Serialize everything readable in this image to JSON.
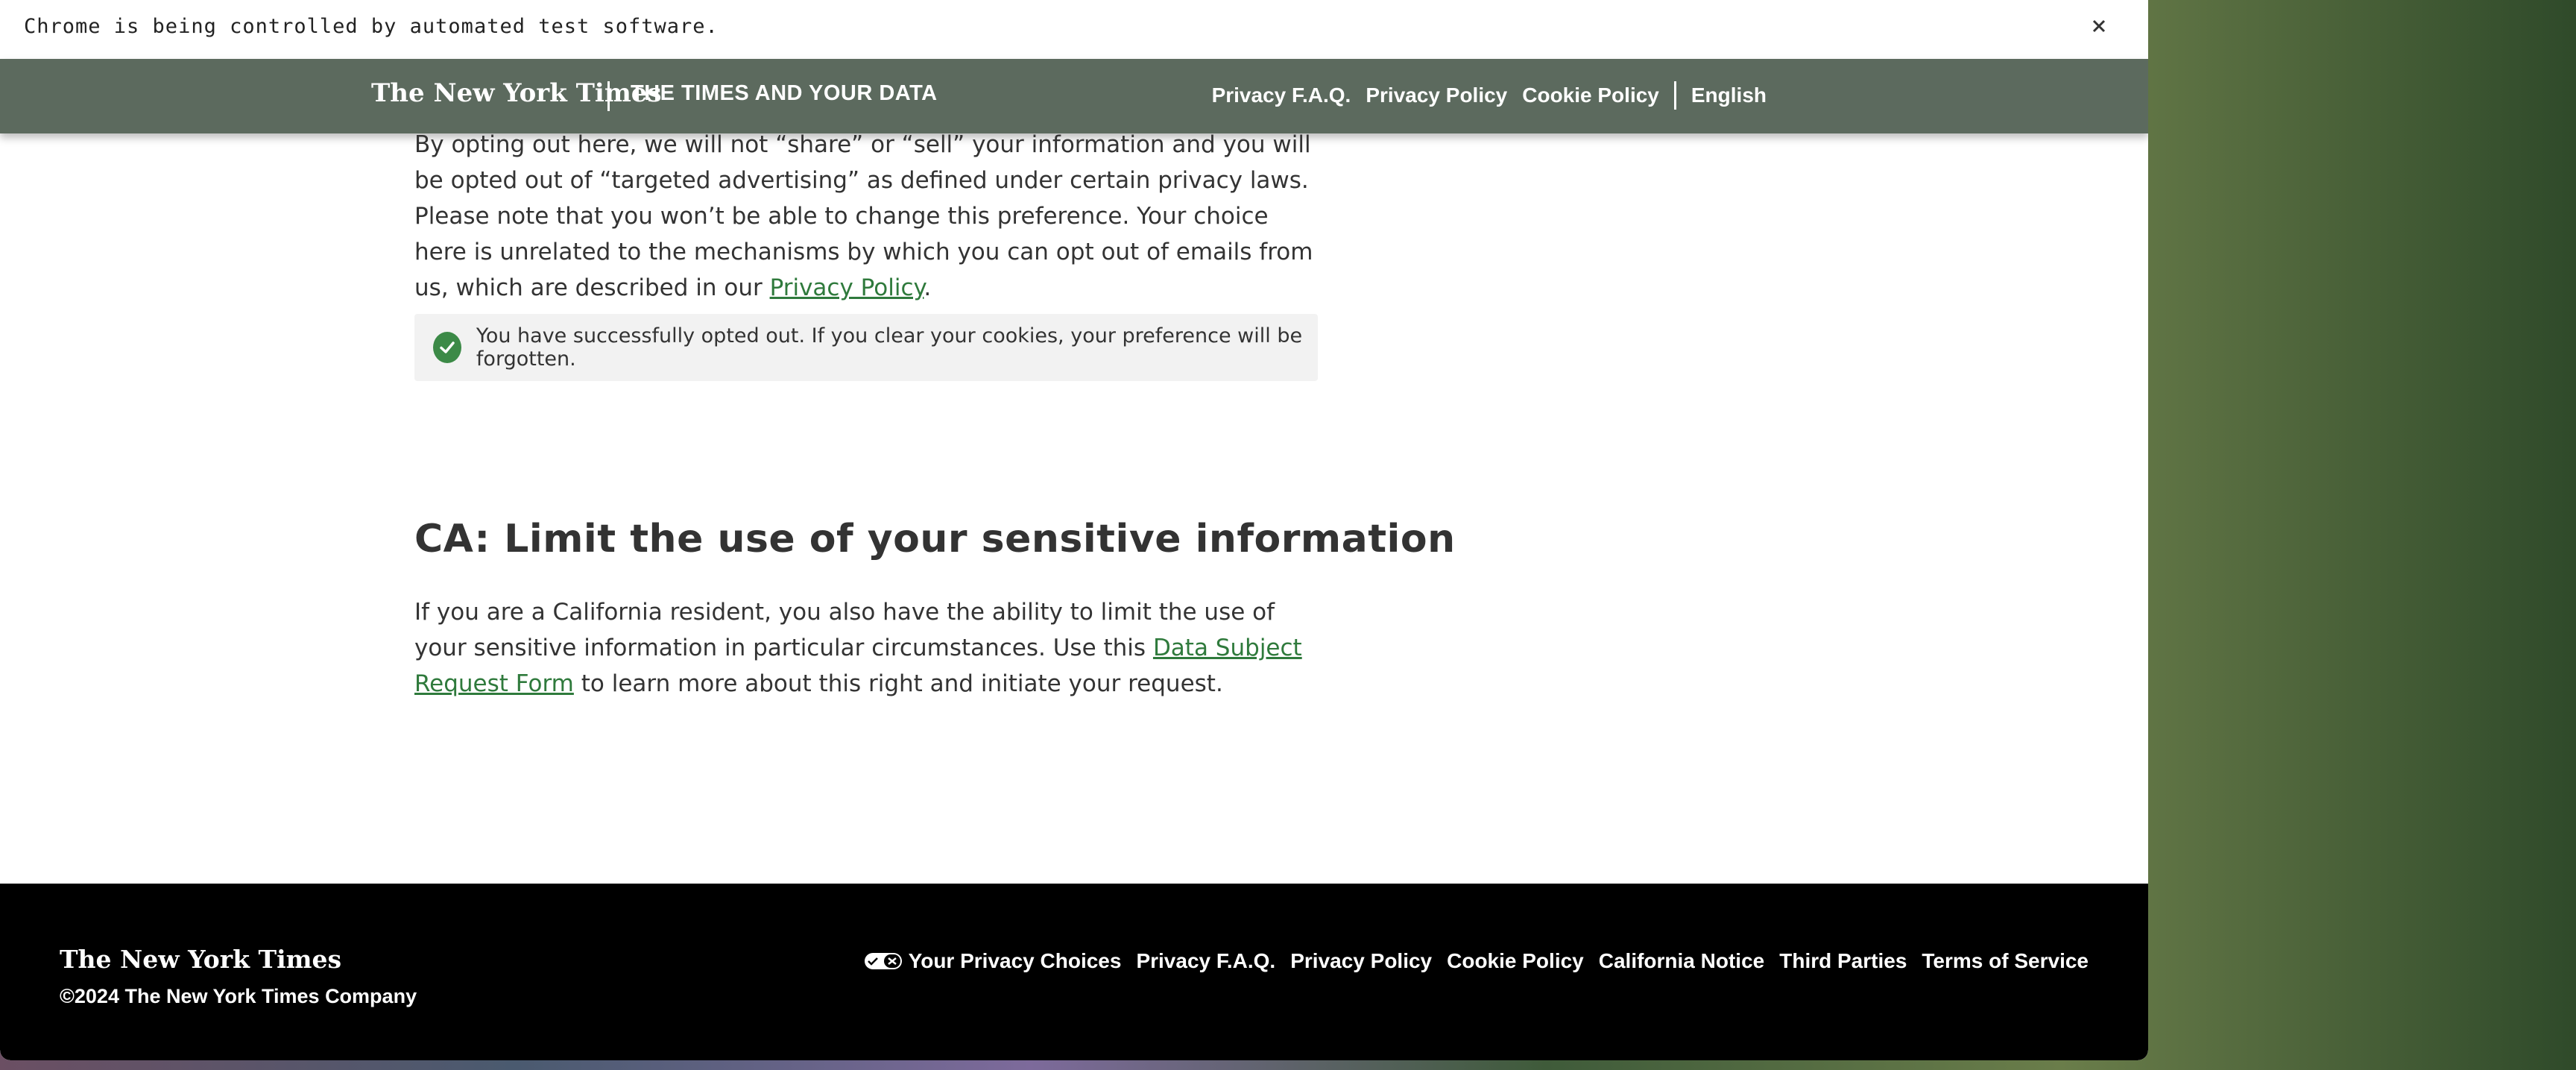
{
  "browser": {
    "infobar_text": "Chrome is being controlled by automated test software."
  },
  "header": {
    "logo": "The New York Times",
    "section_title": "THE TIMES AND YOUR DATA",
    "nav": [
      "Privacy F.A.Q.",
      "Privacy Policy",
      "Cookie Policy"
    ],
    "language": "English"
  },
  "optout": {
    "para_part1": "By opting out here, we will not “share” or “sell” your information and you will be opted out of “targeted advertising” as defined under certain privacy laws. Please note that you won’t be able to change this preference. Your choice here is unrelated to the mechanisms by which you can opt out of emails from us, which are described in our ",
    "para_link": "Privacy Policy",
    "para_end": ".",
    "notice": "You have successfully opted out. If you clear your cookies, your preference will be forgotten."
  },
  "sensitive": {
    "heading": "CA: Limit the use of your sensitive information",
    "para_part1": "If you are a California resident, you also have the ability to limit the use of your sensitive information in particular circumstances. Use this ",
    "para_link": "Data Subject Request Form",
    "para_part2": " to learn more about this right and initiate your request."
  },
  "footer": {
    "logo": "The New York Times",
    "copyright": "©2024 The New York Times Company",
    "privacy_choices": "Your Privacy Choices",
    "links": [
      "Privacy F.A.Q.",
      "Privacy Policy",
      "Cookie Policy",
      "California Notice",
      "Third Parties",
      "Terms of Service"
    ]
  },
  "colors": {
    "header_bg": "#5c6a5e",
    "link_green": "#2f7a3c",
    "check_green": "#3c8a47",
    "footer_bg": "#000000"
  }
}
